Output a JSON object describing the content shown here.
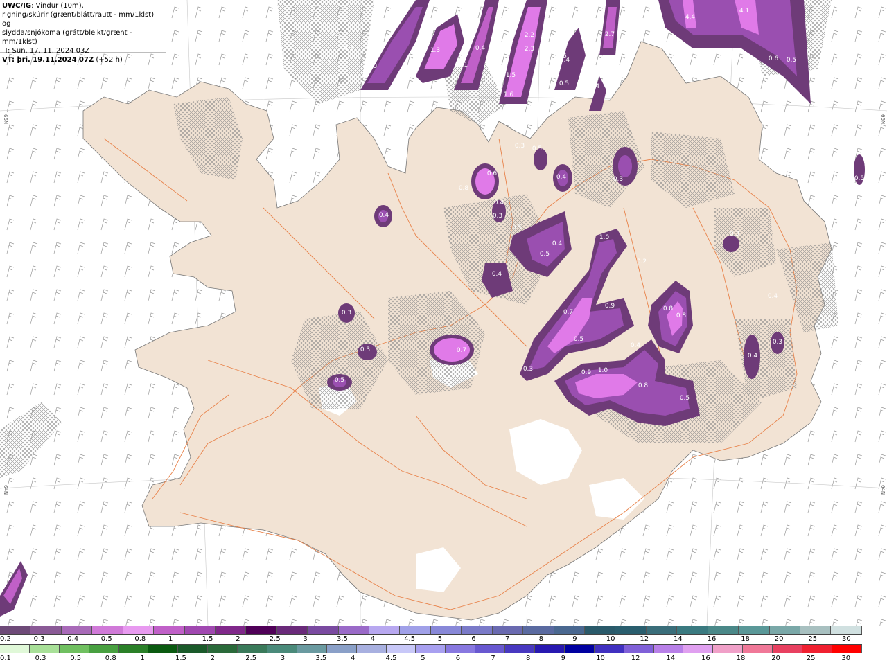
{
  "header": {
    "model": "UWC/IG",
    "line1_rest": ": Vindur (10m),",
    "line2": "rigning/skúrir (grænt/blátt/rautt - mm/1klst) og",
    "line3": "slydda/snjókoma (grátt/bleikt/grænt - mm/1klst)",
    "line4": "IT: Sun. 17. 11. 2024 03Z",
    "line5_bold": "VT: þri. 19.11.2024 07Z",
    "line5_rest": " (+52 h)"
  },
  "colors": {
    "land": "#f2e3d4",
    "sea": "#ffffff",
    "roads": "#e8824a",
    "snow_dark": "#6e3b78",
    "snow_mid": "#9a4fb0",
    "snow_light": "#e07ae8"
  },
  "lat_labels": {
    "left_top": "66N",
    "right_top": "66N",
    "left_bottom": "64N",
    "right_bottom": "64N"
  },
  "precip_labels": [
    {
      "t": "0.3"
    },
    {
      "t": "0.3"
    },
    {
      "t": "0.3"
    },
    {
      "t": "1.0"
    },
    {
      "t": "1.3"
    },
    {
      "t": "1.1"
    },
    {
      "t": "0.4"
    },
    {
      "t": "2.2"
    },
    {
      "t": "2.3"
    },
    {
      "t": "1.5"
    },
    {
      "t": "1.6"
    },
    {
      "t": "+0.5"
    },
    {
      "t": "0.4"
    },
    {
      "t": "0.5"
    },
    {
      "t": "2.7"
    },
    {
      "t": "0.4"
    },
    {
      "t": "4.4"
    },
    {
      "t": "4.1"
    },
    {
      "t": "0.6"
    },
    {
      "t": "0.5"
    },
    {
      "t": "0.3"
    },
    {
      "t": "0.5"
    },
    {
      "t": "0.4"
    },
    {
      "t": "0.4"
    },
    {
      "t": "0.3"
    },
    {
      "t": "0.8"
    },
    {
      "t": "0.6"
    },
    {
      "t": "0.4"
    },
    {
      "t": "0.3"
    },
    {
      "t": "0.5"
    },
    {
      "t": "0.4"
    },
    {
      "t": "0.5"
    },
    {
      "t": "0.4"
    },
    {
      "t": "1.0"
    },
    {
      "t": "0.2"
    },
    {
      "t": "0.3"
    },
    {
      "t": "0.3"
    },
    {
      "t": "0.7"
    },
    {
      "t": "0.9"
    },
    {
      "t": "0.5"
    },
    {
      "t": "0.4"
    },
    {
      "t": "0.8"
    },
    {
      "t": "0.3"
    },
    {
      "t": "0.4"
    },
    {
      "t": "0.3"
    },
    {
      "t": "0.5"
    },
    {
      "t": "0.3"
    },
    {
      "t": "0.5"
    },
    {
      "t": "0.7"
    },
    {
      "t": "0.9"
    },
    {
      "t": "0.8"
    },
    {
      "t": "1.0"
    },
    {
      "t": "0.8"
    },
    {
      "t": "0.5"
    },
    {
      "t": "0.4"
    }
  ],
  "legend": {
    "snow_colors": [
      "#6e4a78",
      "#8a5a96",
      "#a86ab8",
      "#d07ad8",
      "#e89af0",
      "#c060c8",
      "#a048b0",
      "#80288a",
      "#500058",
      "#6a2a7a",
      "#7a4aa0",
      "#9a6ac8",
      "#b8a8f0",
      "#a0a0e8",
      "#8888d8",
      "#7a7ac8",
      "#6a6ab0",
      "#5a6aa0",
      "#4a6890",
      "#2a5a6a",
      "#2a5e6e",
      "#3a6e7a",
      "#3a7a80",
      "#4a8888",
      "#5a9898",
      "#7aa8a8",
      "#a8c0c0",
      "#d0e0e0"
    ],
    "snow_labels": [
      "0.2",
      "0.3",
      "0.4",
      "0.5",
      "0.8",
      "1",
      "1.5",
      "2",
      "2.5",
      "3",
      "3.5",
      "4",
      "4.5",
      "5",
      "6",
      "7",
      "8",
      "9",
      "10",
      "12",
      "14",
      "16",
      "18",
      "20",
      "25",
      "30"
    ],
    "rain_colors": [
      "#e0f8d8",
      "#a8e098",
      "#70c060",
      "#48a040",
      "#2a8028",
      "#0a5a10",
      "#1a5a2a",
      "#2a6a3a",
      "#3a7a5a",
      "#4a8a7a",
      "#6a9aa0",
      "#8aa0c8",
      "#a8b0e0",
      "#c8c8f8",
      "#a8a0f0",
      "#8878e0",
      "#6858d0",
      "#4838c0",
      "#2818b0",
      "#0000a0",
      "#4030c0",
      "#8060d8",
      "#b880e8",
      "#e0a0f0",
      "#f0a0c8",
      "#f07898",
      "#e84060",
      "#f02030",
      "#ff0000"
    ],
    "rain_labels": [
      "0.1",
      "0.3",
      "0.5",
      "0.8",
      "1",
      "1.5",
      "2",
      "2.5",
      "3",
      "3.5",
      "4",
      "4.5",
      "5",
      "6",
      "7",
      "8",
      "9",
      "10",
      "12",
      "14",
      "16",
      "18",
      "20",
      "25",
      "30"
    ]
  }
}
